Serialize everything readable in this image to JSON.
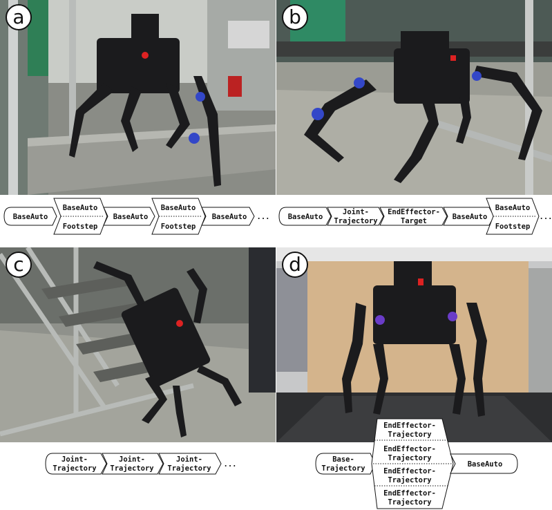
{
  "panels": {
    "a": {
      "label": "a",
      "sequence": [
        "BaseAuto",
        "BaseAuto",
        "Footstep",
        "BaseAuto",
        "BaseAuto",
        "Footstep",
        "BaseAuto",
        "..."
      ]
    },
    "b": {
      "label": "b",
      "sequence": [
        "BaseAuto",
        "Joint-",
        "Trajectory",
        "EndEffector-",
        "Target",
        "BaseAuto",
        "BaseAuto",
        "Footstep",
        "..."
      ]
    },
    "c": {
      "label": "c",
      "sequence": [
        "Joint-",
        "Trajectory",
        "Joint-",
        "Trajectory",
        "Joint-",
        "Trajectory",
        "..."
      ]
    },
    "d": {
      "label": "d",
      "sequence": [
        "Base-",
        "Trajectory",
        "EndEffector-",
        "Trajectory",
        "EndEffector-",
        "Trajectory",
        "EndEffector-",
        "Trajectory",
        "EndEffector-",
        "Trajectory",
        "BaseAuto"
      ]
    }
  },
  "colors": {
    "outline": "#111111",
    "badge_fill": "#ffffff",
    "background": "#ffffff"
  }
}
